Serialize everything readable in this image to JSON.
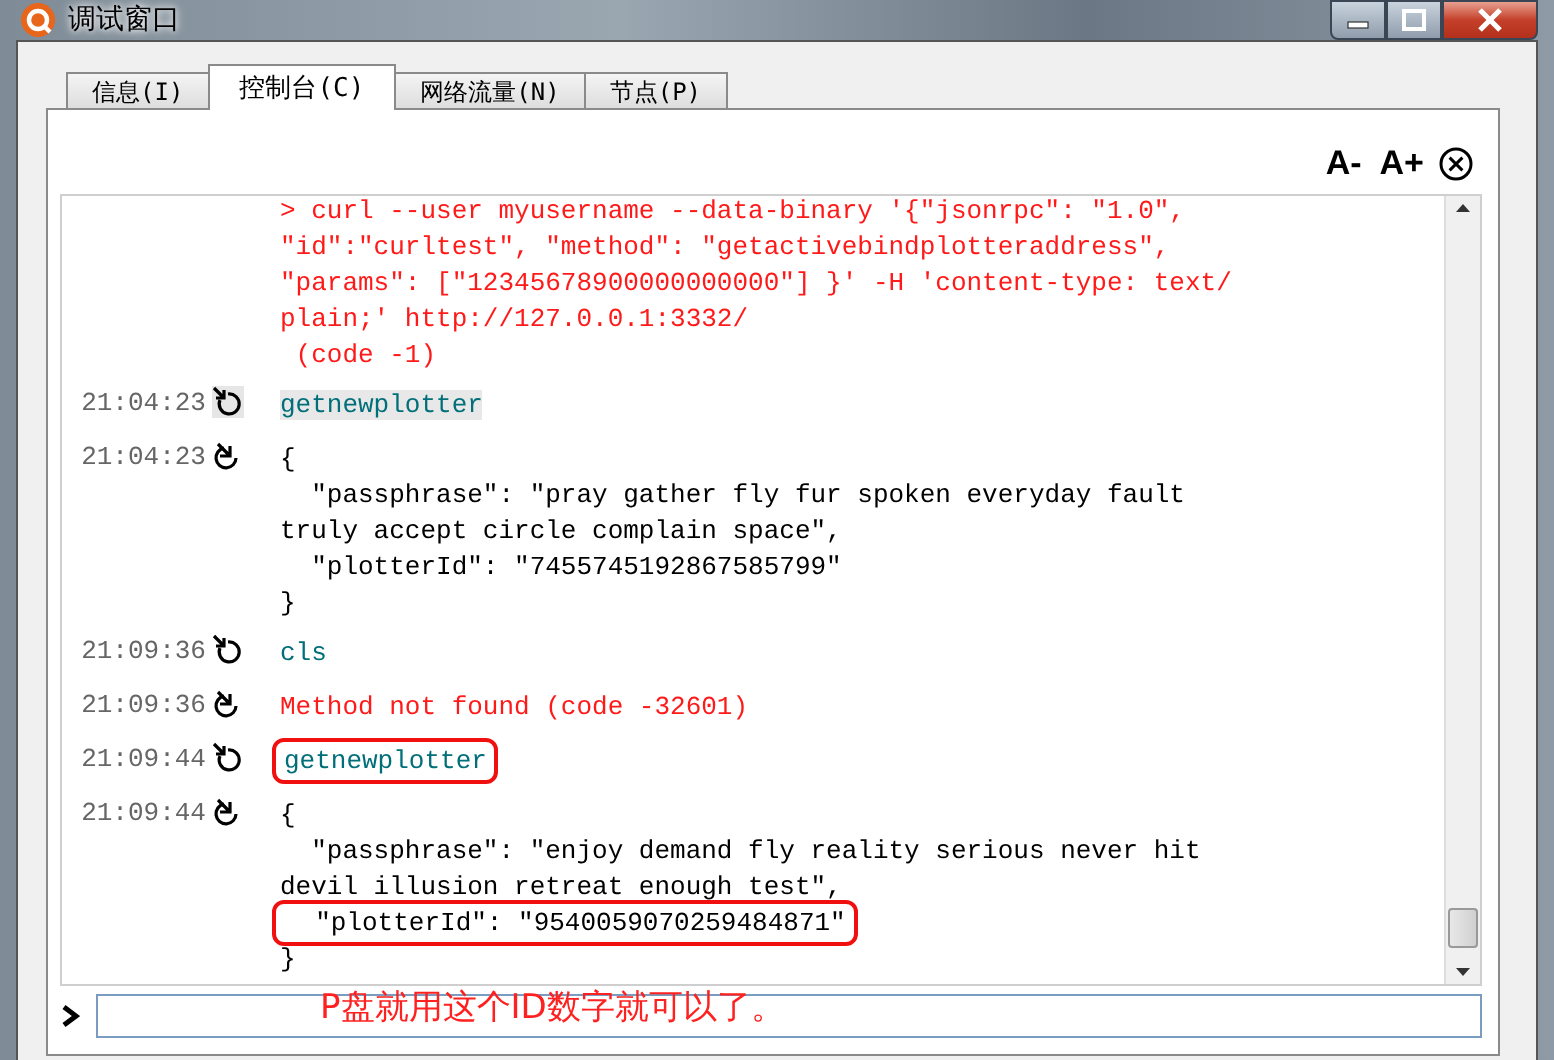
{
  "window": {
    "title": "调试窗口"
  },
  "tabs": [
    {
      "label": "信息(I)",
      "selected": false
    },
    {
      "label": "控制台(C)",
      "selected": true
    },
    {
      "label": "网络流量(N)",
      "selected": false
    },
    {
      "label": "节点(P)",
      "selected": false
    }
  ],
  "font_controls": [
    "A-",
    "A+"
  ],
  "console": [
    {
      "kind": "error",
      "highlighted": false,
      "lines": [
        {
          "text": "> curl --user myusername --data-binary '{\"jsonrpc\": \"1.0\",",
          "boxed": false
        },
        {
          "text": "\"id\":\"curltest\", \"method\": \"getactivebindplotteraddress\",",
          "boxed": false
        },
        {
          "text": "\"params\": [\"12345678900000000000\"] }' -H 'content-type: text/",
          "boxed": false
        },
        {
          "text": "plain;' http://127.0.0.1:3332/",
          "boxed": false
        },
        {
          "text": " (code -1)",
          "boxed": false
        }
      ]
    },
    {
      "time": "21:04:23",
      "kind": "command",
      "highlighted": true,
      "lines": [
        {
          "text": "getnewplotter",
          "boxed": false
        }
      ]
    },
    {
      "time": "21:04:23",
      "kind": "result",
      "highlighted": false,
      "lines": [
        {
          "text": "{",
          "boxed": false
        },
        {
          "text": "  \"passphrase\": \"pray gather fly fur spoken everyday fault",
          "boxed": false
        },
        {
          "text": "truly accept circle complain space\",",
          "boxed": false
        },
        {
          "text": "  \"plotterId\": \"7455745192867585799\"",
          "boxed": false
        },
        {
          "text": "}",
          "boxed": false
        }
      ]
    },
    {
      "time": "21:09:36",
      "kind": "command",
      "highlighted": false,
      "lines": [
        {
          "text": "cls",
          "boxed": false
        }
      ]
    },
    {
      "time": "21:09:36",
      "kind": "error",
      "highlighted": false,
      "lines": [
        {
          "text": "Method not found (code -32601)",
          "boxed": false
        }
      ]
    },
    {
      "time": "21:09:44",
      "kind": "command",
      "highlighted": false,
      "lines": [
        {
          "text": "getnewplotter",
          "boxed": true
        }
      ]
    },
    {
      "time": "21:09:44",
      "kind": "result",
      "highlighted": false,
      "lines": [
        {
          "text": "{",
          "boxed": false
        },
        {
          "text": "  \"passphrase\": \"enjoy demand fly reality serious never hit",
          "boxed": false
        },
        {
          "text": "devil illusion retreat enough test\",",
          "boxed": false
        },
        {
          "text": "  \"plotterId\": \"9540059070259484871\"",
          "boxed": true
        },
        {
          "text": "}",
          "boxed": false
        }
      ]
    }
  ],
  "annotation": "P盘就用这个ID数字就可以了。"
}
